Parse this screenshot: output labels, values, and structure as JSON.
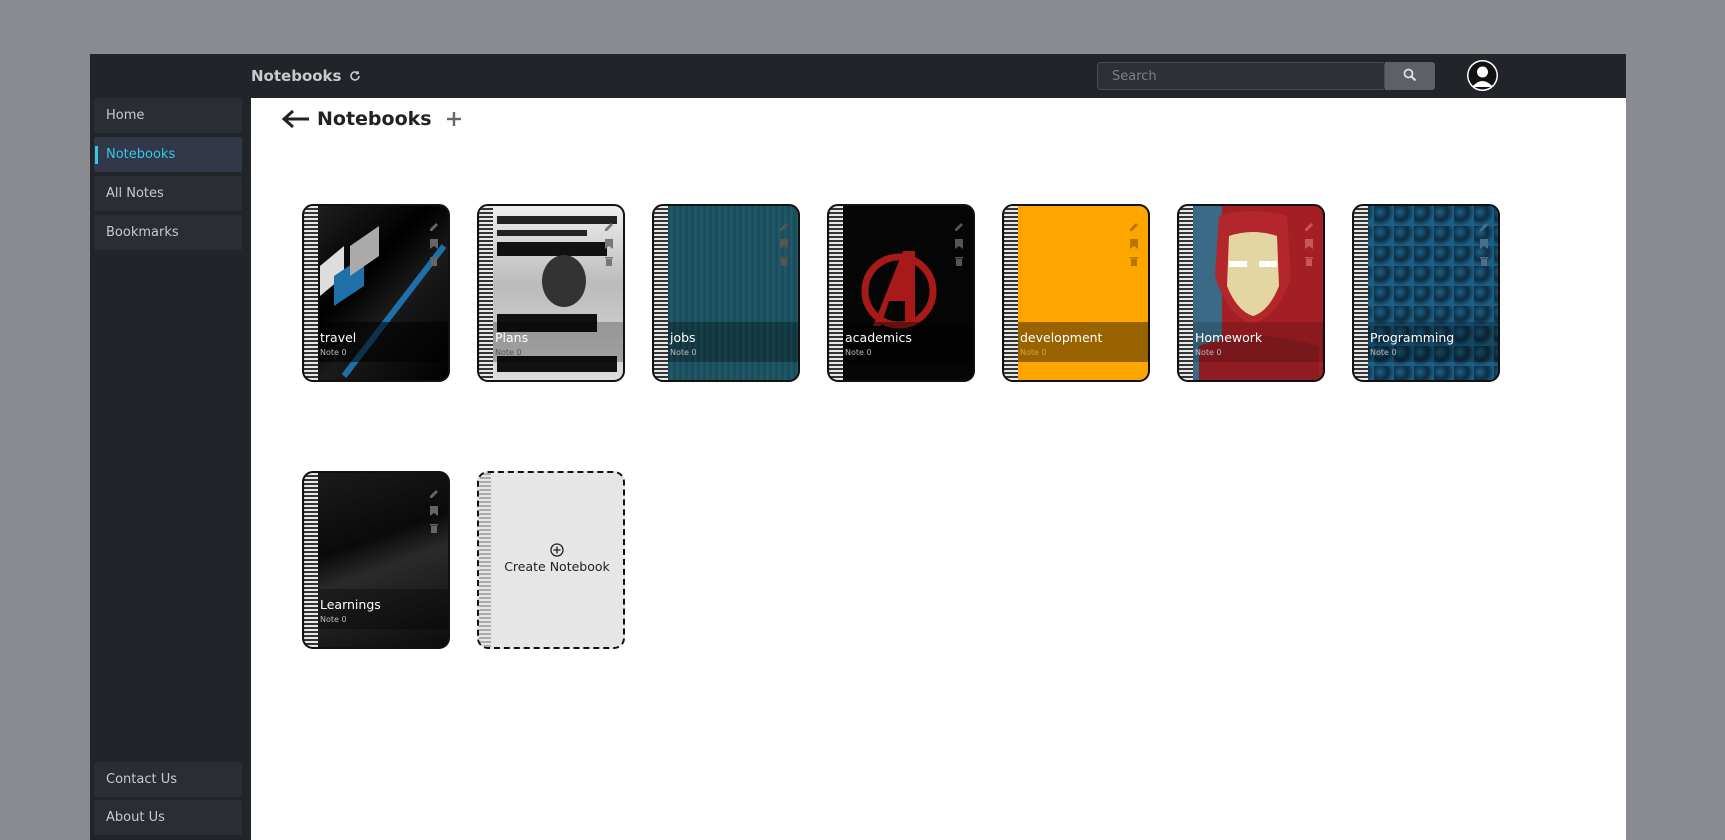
{
  "topbar": {
    "title": "Notebooks",
    "search_placeholder": "Search"
  },
  "sidebar": {
    "items": [
      {
        "label": "Home"
      },
      {
        "label": "Notebooks",
        "active": true
      },
      {
        "label": "All Notes"
      },
      {
        "label": "Bookmarks"
      }
    ],
    "footer": [
      {
        "label": "Contact Us"
      },
      {
        "label": "About Us"
      }
    ]
  },
  "main": {
    "title": "Notebooks",
    "notebooks": [
      {
        "title": "travel",
        "count": "Note 0"
      },
      {
        "title": "Plans",
        "count": "Note 0"
      },
      {
        "title": "jobs",
        "count": "Note 0"
      },
      {
        "title": "academics",
        "count": "Note 0"
      },
      {
        "title": "development",
        "count": "Note 0"
      },
      {
        "title": "Homework",
        "count": "Note 0"
      },
      {
        "title": "Programming",
        "count": "Note 0"
      },
      {
        "title": "Learnings",
        "count": "Note 0"
      }
    ],
    "create_label": "Create Notebook"
  },
  "colors": {
    "accent": "#32c8e6",
    "bar": "#212429",
    "development_cover": "#ffa500",
    "jobs_cover": "#1e5564"
  },
  "icons": [
    "refresh-icon",
    "search-icon",
    "avatar-icon",
    "back-arrow-icon",
    "add-icon",
    "edit-icon",
    "bookmark-icon",
    "trash-icon",
    "plus-circle-icon"
  ]
}
